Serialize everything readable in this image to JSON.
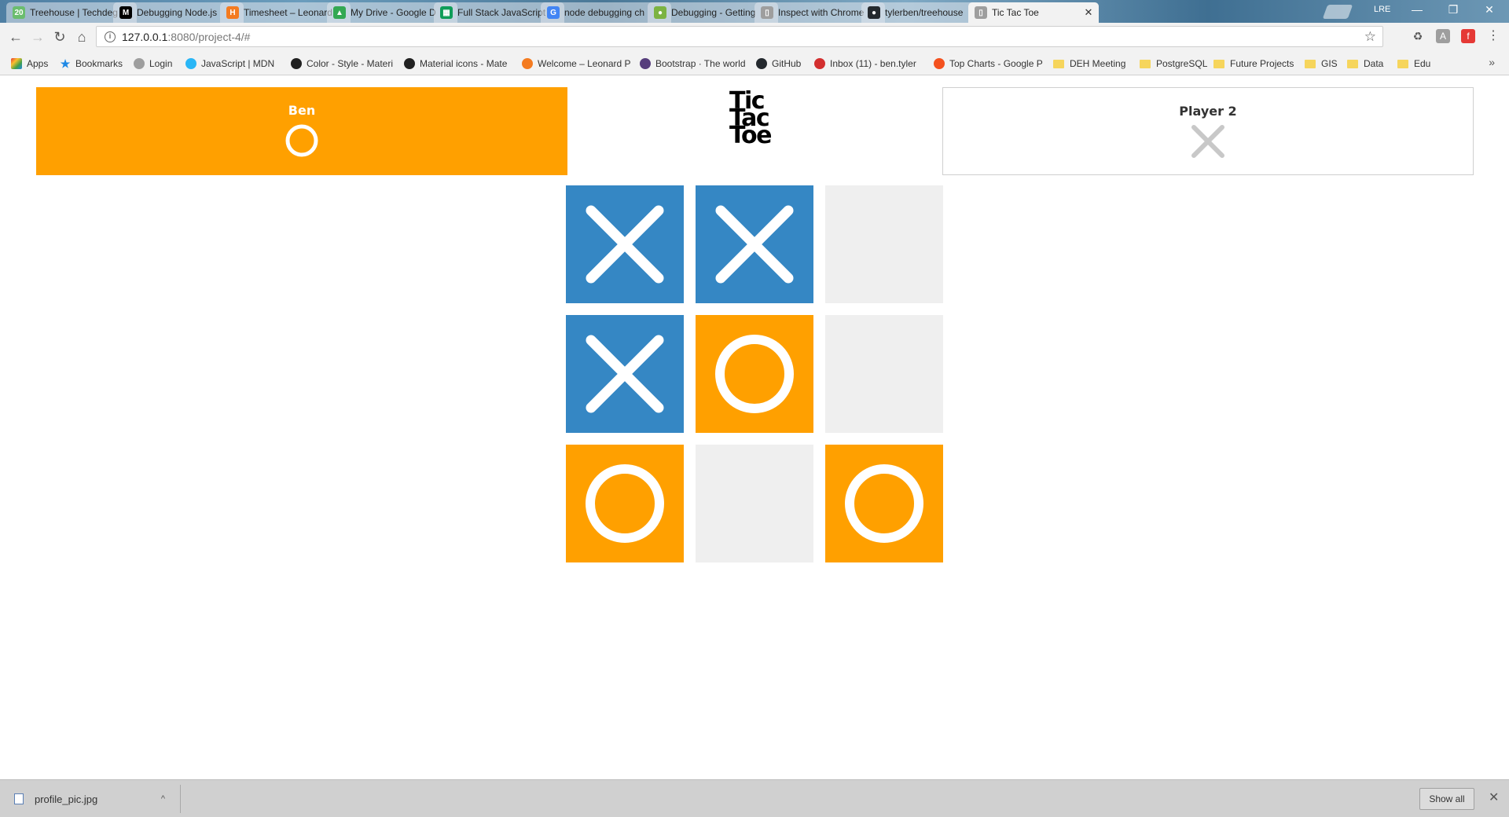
{
  "browser": {
    "tabs": [
      {
        "title": "Treehouse | Techdeg",
        "favicon_color": "#6bbd6e",
        "favicon_char": "20"
      },
      {
        "title": "Debugging Node.js",
        "favicon_color": "#000000",
        "favicon_char": "M"
      },
      {
        "title": "Timesheet – Leonard",
        "favicon_color": "#f47b20",
        "favicon_char": "H"
      },
      {
        "title": "My Drive - Google D",
        "favicon_color": "#34a853",
        "favicon_char": "▲"
      },
      {
        "title": "Full Stack JavaScript",
        "favicon_color": "#0f9d58",
        "favicon_char": "▦"
      },
      {
        "title": "node debugging ch",
        "favicon_color": "#4285f4",
        "favicon_char": "G"
      },
      {
        "title": "Debugging - Getting",
        "favicon_color": "#7cb342",
        "favicon_char": "●"
      },
      {
        "title": "Inspect with Chrome",
        "favicon_color": "#9e9e9e",
        "favicon_char": "▯"
      },
      {
        "title": "tylerben/treehouse",
        "favicon_color": "#24292e",
        "favicon_char": "●"
      },
      {
        "title": "Tic Tac Toe",
        "favicon_color": "#9e9e9e",
        "favicon_char": "▯"
      }
    ],
    "active_tab_index": 9,
    "profile_label": "LRE",
    "window_controls": {
      "minimize": "—",
      "restore": "❐",
      "close": "✕"
    },
    "nav": {
      "back": "←",
      "forward": "→",
      "reload": "↻",
      "home": "⌂"
    },
    "url_host": "127.0.0.1",
    "url_rest": ":8080/project-4/#",
    "star": "☆",
    "bookmarks": [
      {
        "label": "Apps",
        "type": "apps",
        "color": "#e53935"
      },
      {
        "label": "Bookmarks",
        "type": "star",
        "color": "#1e88e5"
      },
      {
        "label": "Login",
        "type": "icon",
        "color": "#9e9e9e"
      },
      {
        "label": "JavaScript | MDN",
        "type": "icon",
        "color": "#29b6f6"
      },
      {
        "label": "Color - Style - Materi",
        "type": "icon",
        "color": "#212121"
      },
      {
        "label": "Material icons - Mate",
        "type": "icon",
        "color": "#212121"
      },
      {
        "label": "Welcome – Leonard P",
        "type": "icon",
        "color": "#f47b20"
      },
      {
        "label": "Bootstrap · The world",
        "type": "icon",
        "color": "#563d7c"
      },
      {
        "label": "GitHub",
        "type": "icon",
        "color": "#24292e"
      },
      {
        "label": "Inbox (11) - ben.tyler",
        "type": "icon",
        "color": "#d32f2f"
      },
      {
        "label": "Top Charts - Google P",
        "type": "icon",
        "color": "#f4511e"
      },
      {
        "label": "DEH Meeting",
        "type": "folder"
      },
      {
        "label": "PostgreSQL",
        "type": "folder"
      },
      {
        "label": "Future Projects",
        "type": "folder"
      },
      {
        "label": "GIS",
        "type": "folder"
      },
      {
        "label": "Data",
        "type": "folder"
      },
      {
        "label": "Edu",
        "type": "folder"
      }
    ],
    "bookmarks_overflow": "»"
  },
  "game": {
    "logo_lines": [
      "Tic",
      "Tac",
      "Toe"
    ],
    "player1": {
      "name": "Ben",
      "symbol": "O",
      "active": true
    },
    "player2": {
      "name": "Player 2",
      "symbol": "X",
      "active": false
    },
    "board": [
      "X",
      "X",
      "",
      "X",
      "O",
      "",
      "O",
      "",
      "O"
    ],
    "colors": {
      "o_fill": "#ffa000",
      "x_fill": "#3587c4",
      "empty_fill": "#efefef",
      "player2_icon": "#c8c8c8"
    }
  },
  "downloads": {
    "file_name": "profile_pic.jpg",
    "caret": "^",
    "show_all_label": "Show all",
    "close": "✕"
  }
}
